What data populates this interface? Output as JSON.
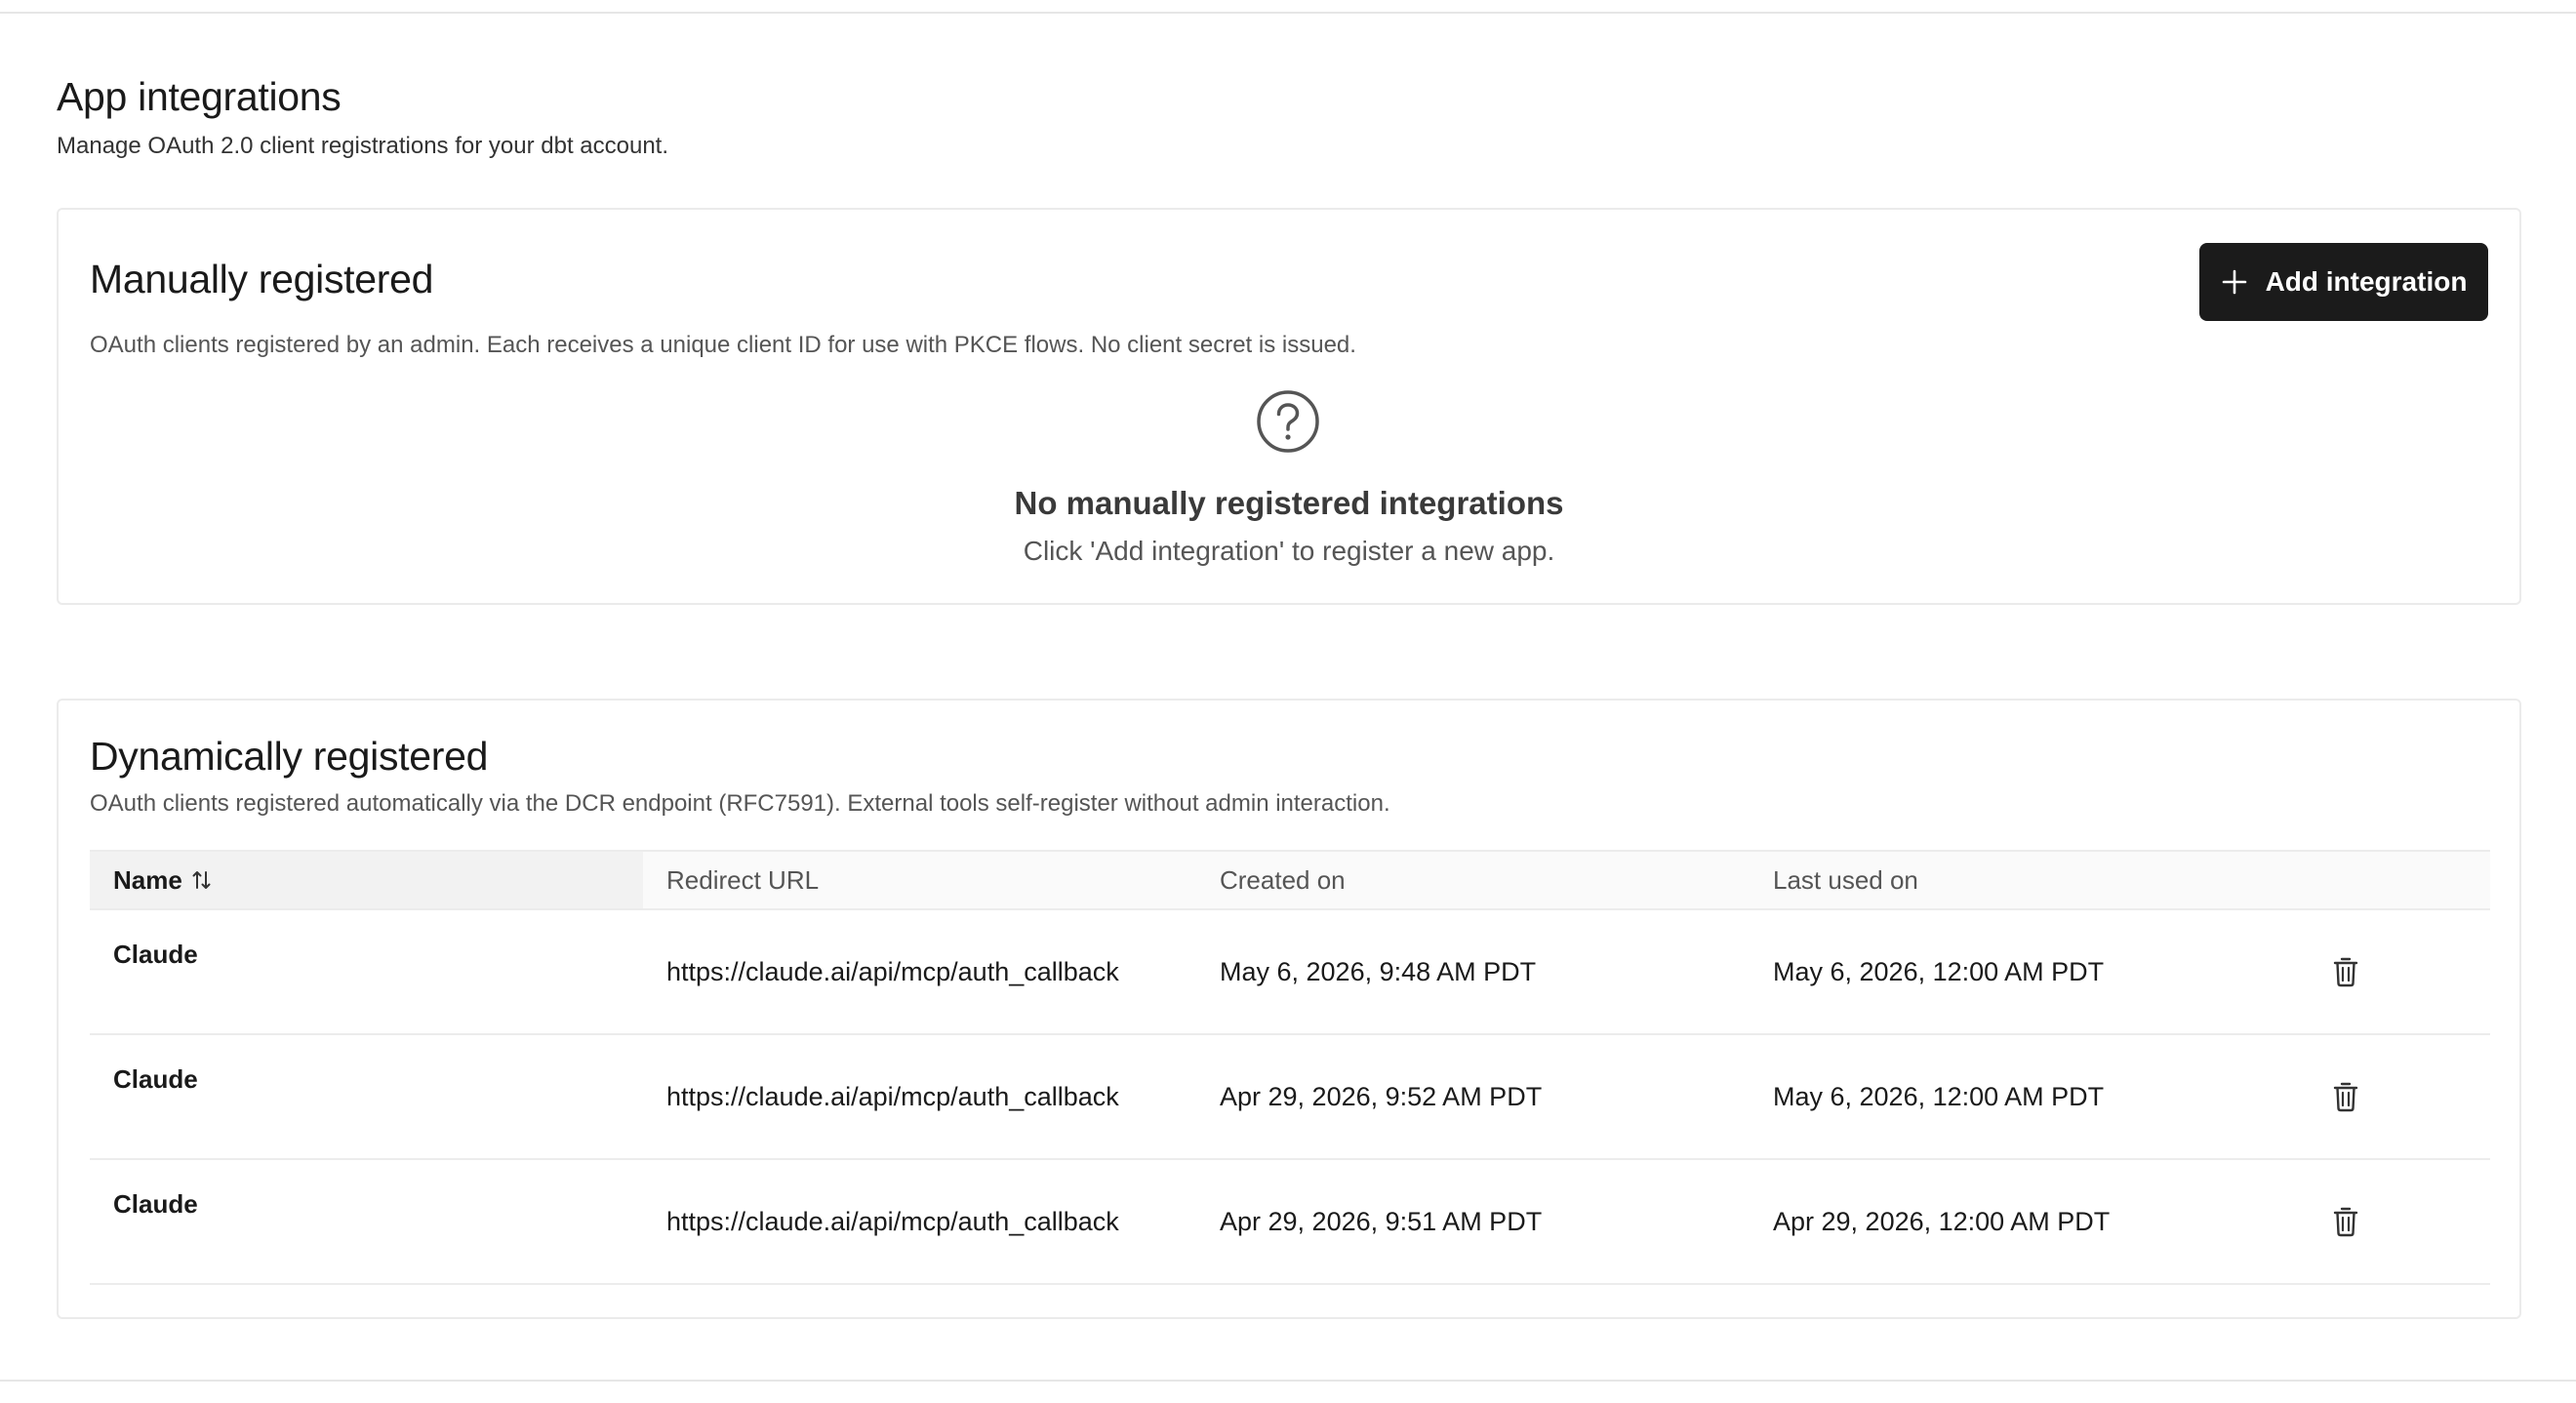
{
  "header": {
    "title": "App integrations",
    "subtitle": "Manage OAuth 2.0 client registrations for your dbt account."
  },
  "manual": {
    "title": "Manually registered",
    "description": "OAuth clients registered by an admin. Each receives a unique client ID for use with PKCE flows. No client secret is issued.",
    "add_button_label": "Add integration",
    "empty_icon": "question-circle-icon",
    "empty_title": "No manually registered integrations",
    "empty_subtitle": "Click 'Add integration' to register a new app."
  },
  "dynamic": {
    "title": "Dynamically registered",
    "description": "OAuth clients registered automatically via the DCR endpoint (RFC7591). External tools self-register without admin interaction.",
    "columns": {
      "name": "Name",
      "redirect": "Redirect URL",
      "created": "Created on",
      "last_used": "Last used on"
    },
    "sort_icon": "sort-arrows-icon",
    "row_action_icon": "trash-icon",
    "rows": [
      {
        "name": "Claude",
        "redirect": "https://claude.ai/api/mcp/auth_callback",
        "created": "May 6, 2026, 9:48 AM PDT",
        "last_used": "May 6, 2026, 12:00 AM PDT"
      },
      {
        "name": "Claude",
        "redirect": "https://claude.ai/api/mcp/auth_callback",
        "created": "Apr 29, 2026, 9:52 AM PDT",
        "last_used": "May 6, 2026, 12:00 AM PDT"
      },
      {
        "name": "Claude",
        "redirect": "https://claude.ai/api/mcp/auth_callback",
        "created": "Apr 29, 2026, 9:51 AM PDT",
        "last_used": "Apr 29, 2026, 12:00 AM PDT"
      }
    ]
  },
  "colors": {
    "primary_button": "#1b1b1b",
    "border": "#ebebeb",
    "muted_text": "#555555"
  }
}
